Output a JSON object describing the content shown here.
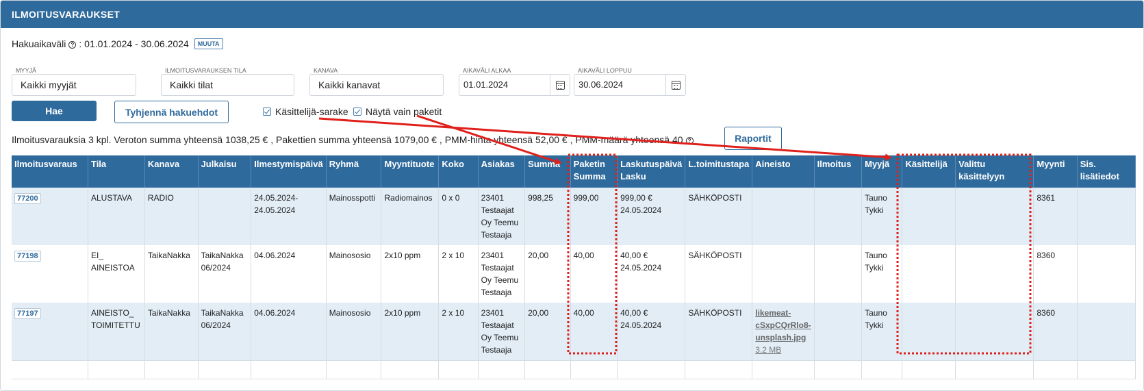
{
  "header": {
    "title": "ILMOITUSVARAUKSET"
  },
  "period": {
    "label": "Hakuaikaväli",
    "help_icon": "?",
    "value": ": 01.01.2024 - 30.06.2024",
    "change_button": "MUUTA"
  },
  "filters": {
    "seller": {
      "label": "MYYJÄ",
      "value": "Kaikki myyjät"
    },
    "status": {
      "label": "ILMOITUSVARAUKSEN TILA",
      "value": "Kaikki tilat"
    },
    "channel": {
      "label": "KANAVA",
      "value": "Kaikki kanavat"
    },
    "start": {
      "label": "AIKAVÄLI ALKAA",
      "value": "01.01.2024"
    },
    "end": {
      "label": "AIKAVÄLI LOPPUU",
      "value": "30.06.2024"
    }
  },
  "actions": {
    "search": "Hae",
    "clear": "Tyhjennä hakuehdot",
    "reports": "Raportit"
  },
  "options": {
    "handler_column": "Käsittelijä-sarake",
    "only_packages": "Näytä vain paketit"
  },
  "summary": {
    "text": "Ilmoitusvarauksia 3 kpl. Veroton summa yhteensä 1038,25 € , Pakettien summa yhteensä 1079,00 € , PMM-hinta yhteensä 52,00 € , PMM-määrä yhteensä 40",
    "help_icon": "?"
  },
  "table": {
    "headers": [
      "Ilmoitusvaraus",
      "Tila",
      "Kanava",
      "Julkaisu",
      "Ilmestymispäivä",
      "Ryhmä",
      "Myyntituote",
      "Koko",
      "Asiakas",
      "Summa",
      "Paketin Summa",
      "Laskutuspäivä Lasku",
      "L.toimitustapa",
      "Aineisto",
      "Ilmoitus",
      "Myyjä",
      "Käsittelijä",
      "Valittu käsittelyyn",
      "Myynti",
      "Sis. lisätiedot"
    ],
    "rows": [
      {
        "id": "77200",
        "tila": "ALUSTAVA",
        "kanava": "RADIO",
        "julkaisu": "",
        "ilmestymis": "24.05.2024-24.05.2024",
        "ryhma": "Mainosspotti",
        "tuote": "Radiomainos",
        "koko": "0 x 0",
        "asiakas": "23401 Testaajat Oy Teemu Testaaja",
        "summa": "998,25",
        "paketti": "999,00",
        "lasku": "999,00 € 24.05.2024",
        "toimitus": "SÄHKÖPOSTI",
        "aineisto": "",
        "aineisto_size": "",
        "ilmoitus": "",
        "myyja": "Tauno Tykki",
        "kasittelija": "",
        "valittu": "",
        "myynti": "8361",
        "lisatiedot": ""
      },
      {
        "id": "77198",
        "tila": "EI_ AINEISTOA",
        "kanava": "TaikaNakka",
        "julkaisu": "TaikaNakka 06/2024",
        "ilmestymis": "04.06.2024",
        "ryhma": "Mainososio",
        "tuote": "2x10 ppm",
        "koko": "2 x 10",
        "asiakas": "23401 Testaajat Oy Teemu Testaaja",
        "summa": "20,00",
        "paketti": "40,00",
        "lasku": "40,00 € 24.05.2024",
        "toimitus": "SÄHKÖPOSTI",
        "aineisto": "",
        "aineisto_size": "",
        "ilmoitus": "",
        "myyja": "Tauno Tykki",
        "kasittelija": "",
        "valittu": "",
        "myynti": "8360",
        "lisatiedot": ""
      },
      {
        "id": "77197",
        "tila": "AINEISTO_ TOIMITETTU",
        "kanava": "TaikaNakka",
        "julkaisu": "TaikaNakka 06/2024",
        "ilmestymis": "04.06.2024",
        "ryhma": "Mainososio",
        "tuote": "2x10 ppm",
        "koko": "2 x 10",
        "asiakas": "23401 Testaajat Oy Teemu Testaaja",
        "summa": "20,00",
        "paketti": "40,00",
        "lasku": "40,00 € 24.05.2024",
        "toimitus": "SÄHKÖPOSTI",
        "aineisto": "likemeat-cSxpCQrRlo8-unsplash.jpg",
        "aineisto_size": "3.2 MB",
        "ilmoitus": "",
        "myyja": "Tauno Tykki",
        "kasittelija": "",
        "valittu": "",
        "myynti": "8360",
        "lisatiedot": ""
      }
    ]
  },
  "colors": {
    "header_bg": "#2f6a9c",
    "row_alt": "#e2edf6",
    "annotation": "#e0201b"
  }
}
